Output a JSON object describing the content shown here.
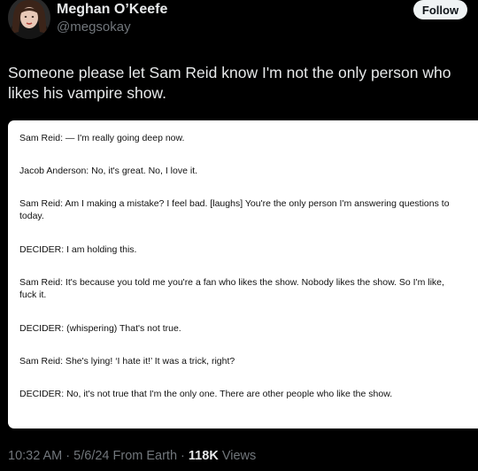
{
  "author": {
    "name": "Meghan O’Keefe",
    "handle": "@megsokay"
  },
  "follow_label": "Follow",
  "tweet_text": "Someone please let Sam Reid know I'm not the only person who likes his vampire show.",
  "transcript": [
    "Sam Reid: — I'm really going deep now.",
    "Jacob Anderson: No, it's great. No, I love it.",
    "Sam Reid: Am I making a mistake? I feel bad. [laughs] You're the only person I'm answering questions to today.",
    "DECIDER: I am holding this.",
    "Sam Reid: It's because you told me you're a fan who likes the show. Nobody likes the show. So I'm like, fuck it.",
    "DECIDER: (whispering) That's not true.",
    "Sam Reid: She's lying! ‘I hate it!’ It was a trick, right?",
    "DECIDER: No, it's not true that I'm the only one. There are other people who like the show."
  ],
  "footer": {
    "time": "10:32 AM",
    "sep1": " · ",
    "date": "5/6/24",
    "source": " From Earth",
    "sep2": " · ",
    "views_count": "118K",
    "views_label": " Views"
  },
  "colors": {
    "background": "#000000",
    "text_primary": "#e7e9ea",
    "text_secondary": "#71767b",
    "follow_button_bg": "#eff3f4"
  }
}
